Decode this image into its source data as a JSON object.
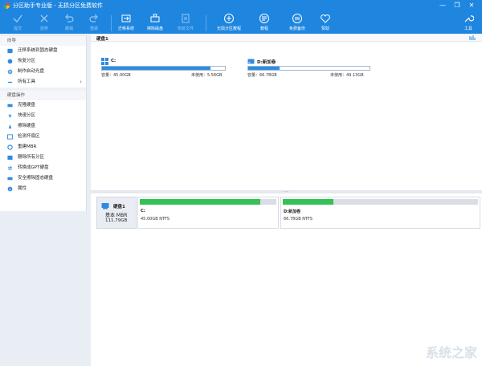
{
  "window": {
    "title": "分区助手专业版 - 无损分区免费软件",
    "controls": [
      "minimize-icon",
      "restore-icon",
      "close-icon"
    ]
  },
  "toolbar": {
    "items": [
      {
        "label": "提交",
        "icon": "check-icon",
        "enabled": false
      },
      {
        "label": "放弃",
        "icon": "cross-icon",
        "enabled": false
      },
      {
        "label": "撤销",
        "icon": "undo-icon",
        "enabled": false
      },
      {
        "label": "重做",
        "icon": "redo-icon",
        "enabled": false
      },
      {
        "label": "迁移系统",
        "icon": "migrate-os-icon",
        "enabled": true
      },
      {
        "label": "擦除磁盘",
        "icon": "wipe-disk-icon",
        "enabled": true
      },
      {
        "label": "恢复文件",
        "icon": "recover-file-icon",
        "enabled": false
      },
      {
        "label": "无损分区教程",
        "icon": "shield-plus-icon",
        "enabled": true
      },
      {
        "label": "教程",
        "icon": "tutorial-icon",
        "enabled": true
      },
      {
        "label": "免费备份",
        "icon": "backup-icon",
        "enabled": true
      },
      {
        "label": "赞助",
        "icon": "heart-icon",
        "enabled": true
      }
    ],
    "tools_label": "工具"
  },
  "sidebar": {
    "wizard_header": "向导",
    "wizard_items": [
      {
        "label": "迁移系统到固态硬盘",
        "icon": "migrate-ssd-icon"
      },
      {
        "label": "恢复分区",
        "icon": "recover-partition-icon"
      },
      {
        "label": "制作启动光盘",
        "icon": "bootable-cd-icon"
      },
      {
        "label": "所有工具",
        "icon": "all-tools-icon",
        "arrow": "›"
      }
    ],
    "disk_ops_header": "硬盘操作",
    "disk_ops_items": [
      {
        "label": "克隆硬盘",
        "icon": "clone-disk-icon"
      },
      {
        "label": "快速分区",
        "icon": "quick-partition-icon"
      },
      {
        "label": "擦除硬盘",
        "icon": "wipe-hard-disk-icon"
      },
      {
        "label": "检测坏扇区",
        "icon": "bad-sector-icon"
      },
      {
        "label": "重建MBR",
        "icon": "rebuild-mbr-icon"
      },
      {
        "label": "删除所有分区",
        "icon": "delete-partitions-icon"
      },
      {
        "label": "转换成GPT硬盘",
        "icon": "convert-gpt-icon"
      },
      {
        "label": "安全擦除固态硬盘",
        "icon": "secure-erase-icon"
      },
      {
        "label": "属性",
        "icon": "properties-icon"
      }
    ]
  },
  "disk_view": {
    "disk_label": "硬盘1",
    "partitions": [
      {
        "name": "C:",
        "icon": "windows-drive-icon",
        "capacity": "容量：45.00GB",
        "free": "未使用：5.56GB",
        "used_fraction": 0.88
      },
      {
        "name": "D:新加卷",
        "icon": "drive-icon",
        "capacity": "容量：66.78GB",
        "free": "未使用：49.13GB",
        "used_fraction": 0.26
      }
    ]
  },
  "disk_map": {
    "disk_name": "硬盘1",
    "disk_type": "基本 MBR",
    "disk_size": "111.79GB",
    "partitions": [
      {
        "name": "C:",
        "info": "45.00GB NTFS",
        "used_fraction": 0.88
      },
      {
        "name": "D:新加卷",
        "info": "66.78GB NTFS",
        "used_fraction": 0.26
      }
    ]
  },
  "splitter_handle": "····",
  "watermark": "系统之家",
  "colors": {
    "accent": "#1f86e0",
    "used_bar": "#2f8be0",
    "partition_bar": "#35c155"
  }
}
